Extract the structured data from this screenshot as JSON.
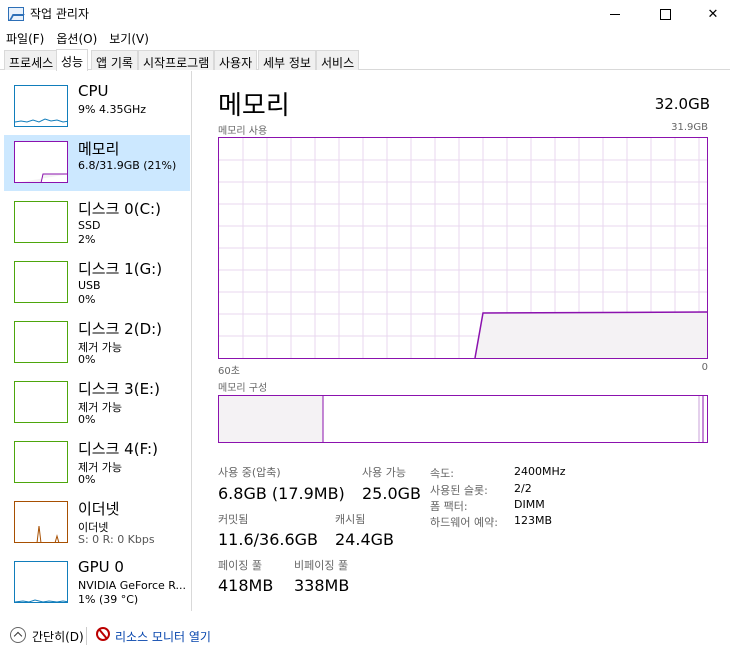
{
  "window": {
    "title": "작업 관리자"
  },
  "menu": [
    "파일(F)",
    "옵션(O)",
    "보기(V)"
  ],
  "tabs": [
    {
      "label": "프로세스"
    },
    {
      "label": "성능",
      "active": true
    },
    {
      "label": "앱 기록"
    },
    {
      "label": "시작프로그램"
    },
    {
      "label": "사용자"
    },
    {
      "label": "세부 정보"
    },
    {
      "label": "서비스"
    }
  ],
  "sidebar": [
    {
      "name": "CPU",
      "line2": "9% 4.35GHz",
      "line3": "",
      "color": "#117dbb"
    },
    {
      "name": "메모리",
      "line2": "6.8/31.9GB (21%)",
      "line3": "",
      "color": "#8b12ae",
      "selected": true
    },
    {
      "name": "디스크 0(C:)",
      "line2": "SSD",
      "line3": "2%",
      "color": "#4da60c"
    },
    {
      "name": "디스크 1(G:)",
      "line2": "USB",
      "line3": "0%",
      "color": "#4da60c"
    },
    {
      "name": "디스크 2(D:)",
      "line2": "제거 가능",
      "line3": "0%",
      "color": "#4da60c"
    },
    {
      "name": "디스크 3(E:)",
      "line2": "제거 가능",
      "line3": "0%",
      "color": "#4da60c"
    },
    {
      "name": "디스크 4(F:)",
      "line2": "제거 가능",
      "line3": "0%",
      "color": "#4da60c"
    },
    {
      "name": "이더넷",
      "line2": "이더넷",
      "line3": "S: 0 R: 0 Kbps",
      "color": "#a74f01"
    },
    {
      "name": "GPU 0",
      "line2": "NVIDIA GeForce R...",
      "line3": "1% (39 °C)",
      "color": "#117dbb"
    }
  ],
  "main": {
    "title": "메모리",
    "total": "32.0GB",
    "usage_label": "메모리 사용",
    "usage_max": "31.9GB",
    "axis_left": "60초",
    "axis_right": "0",
    "composition_label": "메모리 구성",
    "accent": "#8b12ae",
    "fill": "#f4f2f4"
  },
  "stats": {
    "in_use_label": "사용 중(압축)",
    "in_use_value": "6.8GB (17.9MB)",
    "available_label": "사용 가능",
    "available_value": "25.0GB",
    "committed_label": "커밋됨",
    "committed_value": "11.6/36.6GB",
    "cached_label": "캐시됨",
    "cached_value": "24.4GB",
    "paged_label": "페이징 풀",
    "paged_value": "418MB",
    "nonpaged_label": "비페이징 풀",
    "nonpaged_value": "338MB"
  },
  "specs": [
    {
      "key": "속도:",
      "value": "2400MHz"
    },
    {
      "key": "사용된 슬롯:",
      "value": "2/2"
    },
    {
      "key": "폼 팩터:",
      "value": "DIMM"
    },
    {
      "key": "하드웨어 예약:",
      "value": "123MB"
    }
  ],
  "footer": {
    "fewer_details": "간단히(D)",
    "resource_monitor": "리소스 모니터 열기"
  }
}
